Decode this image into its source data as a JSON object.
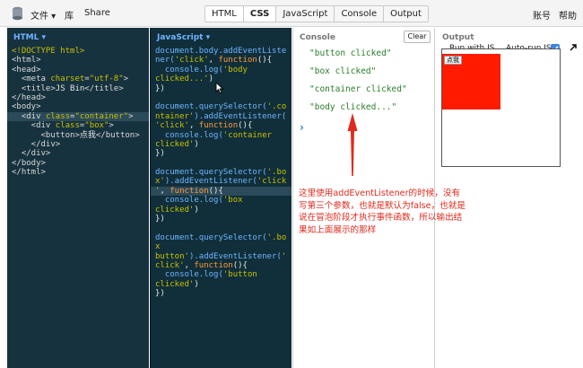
{
  "topbar": {
    "menu_file": "文件 ▾",
    "menu_library": "库",
    "menu_share": "Share",
    "tabs": [
      "HTML",
      "CSS",
      "JavaScript",
      "Console",
      "Output"
    ],
    "account": "账号",
    "help": "帮助"
  },
  "html_panel": {
    "title": "HTML ▾",
    "lines": [
      [
        {
          "c": "t-doc",
          "t": "<!DOCTYPE html>"
        }
      ],
      [
        {
          "c": "t-tag",
          "t": "<html>"
        }
      ],
      [
        {
          "c": "t-tag",
          "t": "<head>"
        }
      ],
      [
        {
          "c": "t-tag",
          "t": "  <meta "
        },
        {
          "c": "t-attr",
          "t": "charset"
        },
        {
          "c": "t-tag",
          "t": "="
        },
        {
          "c": "t-str",
          "t": "\"utf-8\""
        },
        {
          "c": "t-tag",
          "t": ">"
        }
      ],
      [
        {
          "c": "t-tag",
          "t": "  <title>"
        },
        {
          "c": "t-plain",
          "t": "JS Bin"
        },
        {
          "c": "t-tag",
          "t": "</title>"
        }
      ],
      [
        {
          "c": "t-tag",
          "t": "</head>"
        }
      ],
      [
        {
          "c": "t-tag",
          "t": "<body>"
        }
      ],
      [
        {
          "c": "t-tag",
          "t": "  <div "
        },
        {
          "c": "t-attr",
          "t": "class"
        },
        {
          "c": "t-tag",
          "t": "="
        },
        {
          "c": "t-str",
          "t": "\"container\""
        },
        {
          "c": "t-tag",
          "t": ">"
        }
      ],
      [
        {
          "c": "t-tag",
          "t": "    <div "
        },
        {
          "c": "t-attr",
          "t": "class"
        },
        {
          "c": "t-tag",
          "t": "="
        },
        {
          "c": "t-str",
          "t": "\"box\""
        },
        {
          "c": "t-tag",
          "t": ">"
        }
      ],
      [
        {
          "c": "t-tag",
          "t": "      <button>"
        },
        {
          "c": "t-plain",
          "t": "点我"
        },
        {
          "c": "t-tag",
          "t": "</button>"
        }
      ],
      [
        {
          "c": "t-tag",
          "t": "    </div>"
        }
      ],
      [
        {
          "c": "t-tag",
          "t": "  </div>"
        }
      ],
      [
        {
          "c": "t-tag",
          "t": "</body>"
        }
      ],
      [
        {
          "c": "t-tag",
          "t": "</html>"
        }
      ]
    ],
    "highlight_line": 7
  },
  "js_panel": {
    "title": "JavaScript ▾",
    "lines": [
      [
        {
          "c": "t-fn",
          "t": "document.body.addEventListe"
        }
      ],
      [
        {
          "c": "t-fn",
          "t": "ner("
        },
        {
          "c": "t-str",
          "t": "'click'"
        },
        {
          "c": "t-plain",
          "t": ", "
        },
        {
          "c": "t-kw",
          "t": "function"
        },
        {
          "c": "t-plain",
          "t": "(){"
        }
      ],
      [
        {
          "c": "t-plain",
          "t": "  "
        },
        {
          "c": "t-fn",
          "t": "console.log("
        },
        {
          "c": "t-str",
          "t": "'body"
        }
      ],
      [
        {
          "c": "t-str",
          "t": "clicked...'"
        },
        {
          "c": "t-plain",
          "t": ")"
        }
      ],
      [
        {
          "c": "t-plain",
          "t": "})"
        }
      ],
      [
        {
          "c": "t-plain",
          "t": ""
        }
      ],
      [
        {
          "c": "t-fn",
          "t": "document.querySelector("
        },
        {
          "c": "t-str",
          "t": "'.co"
        }
      ],
      [
        {
          "c": "t-str",
          "t": "ntainer'"
        },
        {
          "c": "t-fn",
          "t": ").addEventListener("
        }
      ],
      [
        {
          "c": "t-str",
          "t": "'click'"
        },
        {
          "c": "t-plain",
          "t": ", "
        },
        {
          "c": "t-kw",
          "t": "function"
        },
        {
          "c": "t-plain",
          "t": "(){"
        }
      ],
      [
        {
          "c": "t-plain",
          "t": "  "
        },
        {
          "c": "t-fn",
          "t": "console.log("
        },
        {
          "c": "t-str",
          "t": "'container"
        }
      ],
      [
        {
          "c": "t-str",
          "t": "clicked'"
        },
        {
          "c": "t-plain",
          "t": ")"
        }
      ],
      [
        {
          "c": "t-plain",
          "t": "})"
        }
      ],
      [
        {
          "c": "t-plain",
          "t": ""
        }
      ],
      [
        {
          "c": "t-fn",
          "t": "document.querySelector("
        },
        {
          "c": "t-str",
          "t": "'.bo"
        }
      ],
      [
        {
          "c": "t-str",
          "t": "x'"
        },
        {
          "c": "t-fn",
          "t": ").addEventListener("
        },
        {
          "c": "t-str",
          "t": "'click"
        }
      ],
      [
        {
          "c": "t-str",
          "t": "'"
        },
        {
          "c": "t-plain",
          "t": ", "
        },
        {
          "c": "t-kw",
          "t": "function"
        },
        {
          "c": "t-plain",
          "t": "(){"
        }
      ],
      [
        {
          "c": "t-plain",
          "t": "  "
        },
        {
          "c": "t-fn",
          "t": "console.log("
        },
        {
          "c": "t-str",
          "t": "'box"
        }
      ],
      [
        {
          "c": "t-str",
          "t": "clicked'"
        },
        {
          "c": "t-plain",
          "t": ")"
        }
      ],
      [
        {
          "c": "t-plain",
          "t": "})"
        }
      ],
      [
        {
          "c": "t-plain",
          "t": ""
        }
      ],
      [
        {
          "c": "t-fn",
          "t": "document.querySelector("
        },
        {
          "c": "t-str",
          "t": "'.bo"
        }
      ],
      [
        {
          "c": "t-str",
          "t": "x"
        }
      ],
      [
        {
          "c": "t-str",
          "t": "button'"
        },
        {
          "c": "t-fn",
          "t": ").addEventListener("
        },
        {
          "c": "t-str",
          "t": "'"
        }
      ],
      [
        {
          "c": "t-str",
          "t": "click'"
        },
        {
          "c": "t-plain",
          "t": ", "
        },
        {
          "c": "t-kw",
          "t": "function"
        },
        {
          "c": "t-plain",
          "t": "(){"
        }
      ],
      [
        {
          "c": "t-plain",
          "t": "  "
        },
        {
          "c": "t-fn",
          "t": "console.log("
        },
        {
          "c": "t-str",
          "t": "'button"
        }
      ],
      [
        {
          "c": "t-str",
          "t": "clicked'"
        },
        {
          "c": "t-plain",
          "t": ")"
        }
      ],
      [
        {
          "c": "t-plain",
          "t": "})"
        }
      ]
    ],
    "highlight_line": 15
  },
  "console": {
    "title": "Console",
    "clear_label": "Clear",
    "logs": [
      "\"button clicked\"",
      "\"box clicked\"",
      "\"container clicked\"",
      "\"body clicked...\""
    ],
    "prompt": "›"
  },
  "output": {
    "title": "Output",
    "run_with_js": "Run with JS",
    "auto_run_js": "Auto-run JS",
    "button_label": "点我"
  },
  "annotation": {
    "text": "这里使用addEventListener的时候，没有写第三个参数，也就是默认为false，也就是说在冒泡阶段才执行事件函数，所以输出结果如上面展示的那样"
  },
  "colors": {
    "accent_blue": "#6fb4ff",
    "log_green": "#2a7d2a",
    "annotation_red": "#e02a1c",
    "box_red": "#ff1a00"
  }
}
